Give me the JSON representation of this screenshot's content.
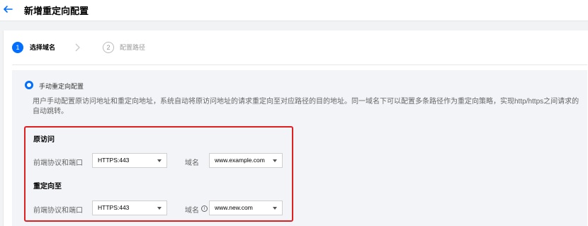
{
  "header": {
    "title": "新增重定向配置"
  },
  "steps": [
    {
      "number": "1",
      "label": "选择域名"
    },
    {
      "number": "2",
      "label": "配置路径"
    }
  ],
  "mode": {
    "radio_label": "手动重定向配置",
    "description": "用户手动配置原访问地址和重定向地址，系统自动将原访问地址的请求重定向至对应路径的目的地址。同一域名下可以配置多条路径作为重定向策略，实现http/https之间请求的自动跳转。"
  },
  "origin": {
    "title": "原访问",
    "protocol_label": "前端协议和端口",
    "protocol_value": "HTTPS:443",
    "domain_label": "域名",
    "domain_value": "www.example.com"
  },
  "redirect": {
    "title": "重定向至",
    "protocol_label": "前端协议和端口",
    "protocol_value": "HTTPS:443",
    "domain_label": "域名",
    "info_icon": "ⓘ",
    "domain_value": "www.new.com"
  },
  "colors": {
    "accent": "#006eff",
    "highlight": "#e02020"
  }
}
